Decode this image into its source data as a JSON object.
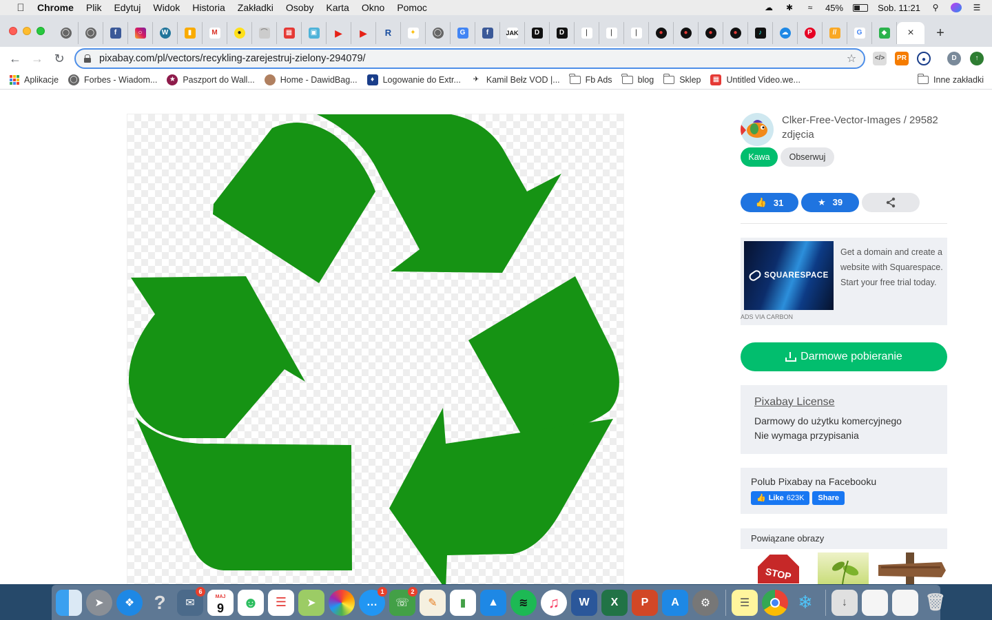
{
  "menubar": {
    "app_name": "Chrome",
    "items": [
      "Plik",
      "Edytuj",
      "Widok",
      "Historia",
      "Zakładki",
      "Osoby",
      "Karta",
      "Okno",
      "Pomoc"
    ],
    "battery": "45%",
    "clock": "Sob. 11:21"
  },
  "browser": {
    "url": "pixabay.com/pl/vectors/recykling-zarejestruj-zielony-294079/",
    "tab_count_visible": 35,
    "active_tab_close": "×",
    "new_tab": "+",
    "profile_initial": "D"
  },
  "bookmarks": [
    {
      "label": "Aplikacje",
      "icon": "apps-grid-icon"
    },
    {
      "label": "Forbes - Wiadom...",
      "icon": "globe-icon"
    },
    {
      "label": "Paszport do Wall...",
      "icon": "star-badge-icon"
    },
    {
      "label": "Home - DawidBag...",
      "icon": "avatar-icon"
    },
    {
      "label": "Logowanie do Extr...",
      "icon": "extreme-icon"
    },
    {
      "label": "Kamil Bełz VOD |...",
      "icon": "plane-icon"
    },
    {
      "label": "Fb Ads",
      "icon": "folder-icon"
    },
    {
      "label": "blog",
      "icon": "folder-icon"
    },
    {
      "label": "Sklep",
      "icon": "folder-icon"
    },
    {
      "label": "Untitled Video.we...",
      "icon": "video-icon"
    }
  ],
  "other_bookmarks": "Inne zakładki",
  "author": {
    "name_line": "Clker-Free-Vector-Images / 29582 zdjęcia",
    "coffee_label": "Kawa",
    "follow_label": "Obserwuj"
  },
  "stats": {
    "likes": "31",
    "favorites": "39"
  },
  "ad": {
    "brand": "SQUARESPACE",
    "text": "Get a domain and create a website with Squarespace. Start your free trial today.",
    "via": "ADS VIA CARBON"
  },
  "download": {
    "label": "Darmowe pobieranie"
  },
  "license": {
    "link": "Pixabay License",
    "line1": "Darmowy do użytku komercyjnego",
    "line2": "Nie wymaga przypisania"
  },
  "facebook": {
    "title": "Polub Pixabay na Facebooku",
    "like_label": "Like",
    "like_count": "623K",
    "share_label": "Share"
  },
  "related": {
    "title": "Powiązane obrazy",
    "items": [
      "stop-sign-image",
      "plant-leaves-image",
      "wooden-signpost-image"
    ]
  },
  "image": {
    "subject": "recycling-symbol",
    "color": "#169314"
  },
  "dock": {
    "calendar_month": "MAJ",
    "calendar_day": "9",
    "badges": {
      "mail": "6",
      "messages": "1",
      "facetime": "2"
    }
  }
}
